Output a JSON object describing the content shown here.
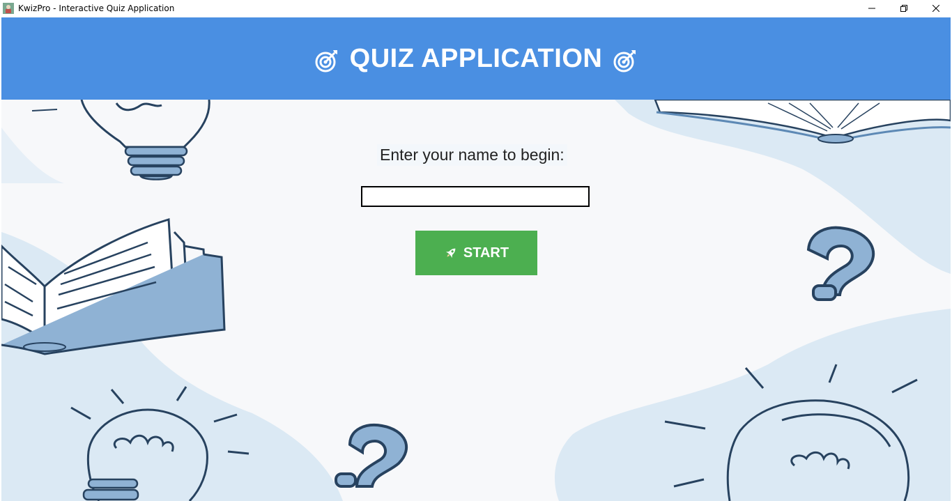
{
  "window": {
    "title": "KwizPro - Interactive Quiz Application"
  },
  "header": {
    "title": "QUIZ APPLICATION",
    "left_icon": "direct-hit-dart-icon",
    "right_icon": "direct-hit-dart-icon",
    "color": "#4a8fe2"
  },
  "form": {
    "prompt": "Enter your name to begin:",
    "name_value": "",
    "name_placeholder": ""
  },
  "start_button": {
    "label": "START",
    "icon": "rocket-icon",
    "color": "#4caf50"
  }
}
